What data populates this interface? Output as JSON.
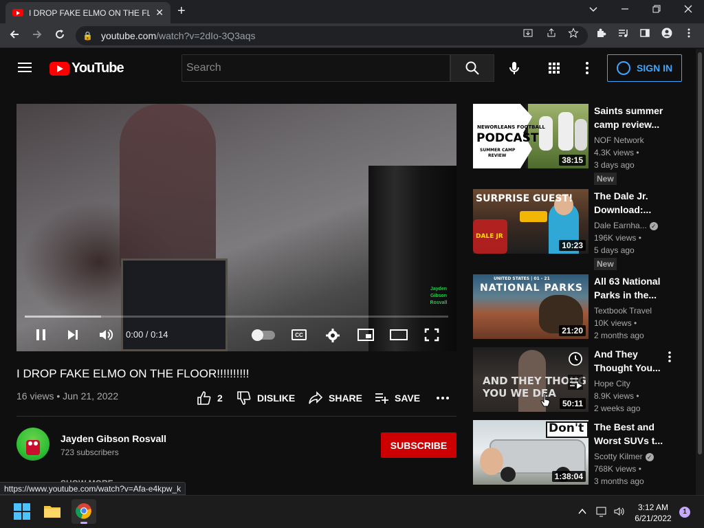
{
  "browser": {
    "tab_title": "I DROP FAKE ELMO ON THE FLOOR",
    "url_host": "youtube.com",
    "url_path": "/watch?v=2dIo-3Q3aqs",
    "status_url": "https://www.youtube.com/watch?v=Afa-e4kpw_k"
  },
  "header": {
    "logo_text": "YouTube",
    "search_placeholder": "Search",
    "sign_in_label": "SIGN IN"
  },
  "player": {
    "time_display": "0:00 / 0:14",
    "watermark_lines": [
      "Jayden",
      "Gibson",
      "Rosvall"
    ],
    "cc_label": "CC"
  },
  "video": {
    "title": "I DROP FAKE ELMO ON THE FLOOR!!!!!!!!!!",
    "info": "16 views • Jun 21, 2022",
    "like_count": "2",
    "dislike_label": "DISLIKE",
    "share_label": "SHARE",
    "save_label": "SAVE"
  },
  "channel": {
    "name": "Jayden Gibson Rosvall",
    "subscribers": "723 subscribers",
    "subscribe_label": "SUBSCRIBE",
    "show_more_label": "SHOW MORE"
  },
  "recommendations": [
    {
      "title": "Saints summer camp review...",
      "channel": "NOF Network",
      "views": "4.3K views •",
      "age": "3 days ago",
      "badge": "New",
      "duration": "38:15",
      "verified": false,
      "thumb_text": [
        "NEWORLEANS FOOTBALL",
        "PODCAST",
        "SUMMER CAMP",
        "REVIEW"
      ]
    },
    {
      "title": "The Dale Jr. Download:...",
      "channel": "Dale Earnha...",
      "views": "196K views •",
      "age": "5 days ago",
      "badge": "New",
      "duration": "10:23",
      "verified": true,
      "thumb_text": [
        "SURPRISE GUEST!",
        "DALE JR"
      ]
    },
    {
      "title": "All 63 National Parks in the...",
      "channel": "Textbook Travel",
      "views": "10K views •",
      "age": "2 months ago",
      "badge": "",
      "duration": "21:20",
      "verified": false,
      "thumb_text": [
        "UNITED STATES | 01 - 21",
        "NATIONAL PARKS"
      ]
    },
    {
      "title": "And They Thought You...",
      "channel": "Hope City",
      "views": "8.9K views •",
      "age": "2 weeks ago",
      "badge": "",
      "duration": "50:11",
      "verified": false,
      "thumb_text": [
        "AND THEY THOUG",
        "YOU WE DEA"
      ]
    },
    {
      "title": "The Best and Worst SUVs t...",
      "channel": "Scotty Kilmer",
      "views": "768K views •",
      "age": "3 months ago",
      "badge": "",
      "duration": "1:38:04",
      "verified": true,
      "thumb_text": [
        "Don't"
      ]
    }
  ],
  "taskbar": {
    "time": "3:12 AM",
    "date": "6/21/2022",
    "notification_count": "1"
  }
}
